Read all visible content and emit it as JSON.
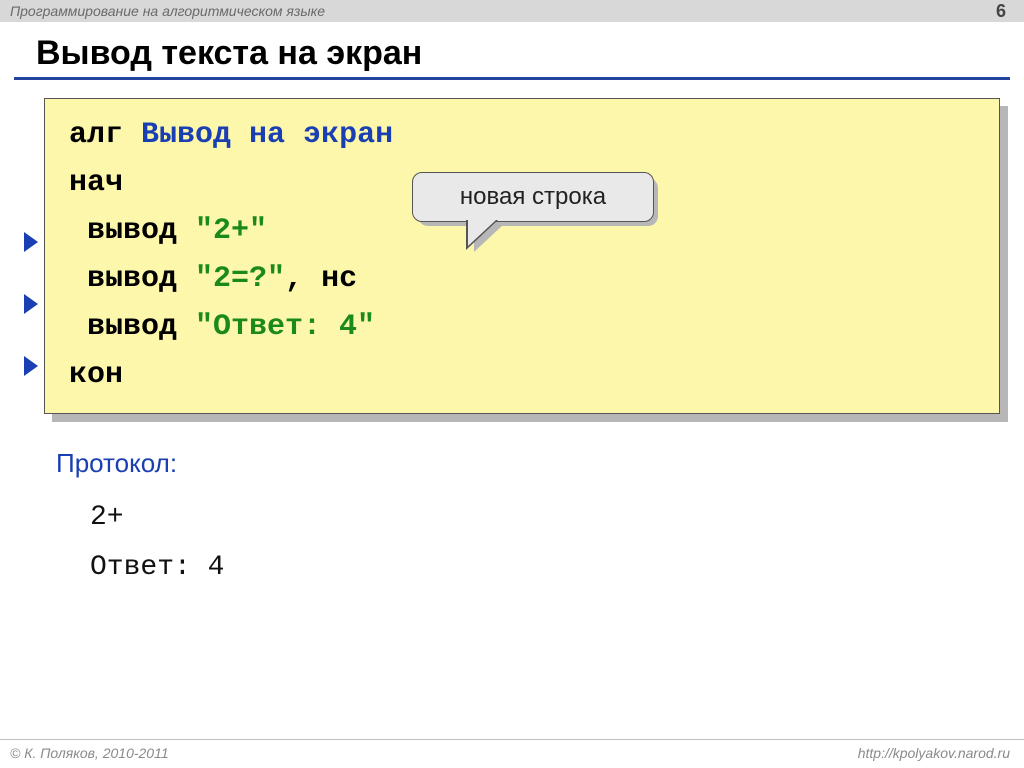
{
  "header": {
    "subject": "Программирование на алгоритмическом языке",
    "page": "6"
  },
  "title": "Вывод текста на экран",
  "code": {
    "kw_alg": "алг",
    "prog_name": "Вывод на экран",
    "kw_begin": "нач",
    "line1_kw": " вывод ",
    "line1_str": "\"2+\"",
    "line2_kw": " вывод ",
    "line2_str": "\"2=?\"",
    "line2_sep": ", ",
    "line2_ns": "нс",
    "line3_kw": " вывод ",
    "line3_str": "\"Ответ: 4\"",
    "kw_end": "кон"
  },
  "callout": "новая строка",
  "protocol": {
    "label": "Протокол",
    "colon": ":",
    "out1": "2+",
    "out2": "Ответ: 4"
  },
  "footer": {
    "copyright": "© К. Поляков, 2010-2011",
    "url": "http://kpolyakov.narod.ru"
  }
}
